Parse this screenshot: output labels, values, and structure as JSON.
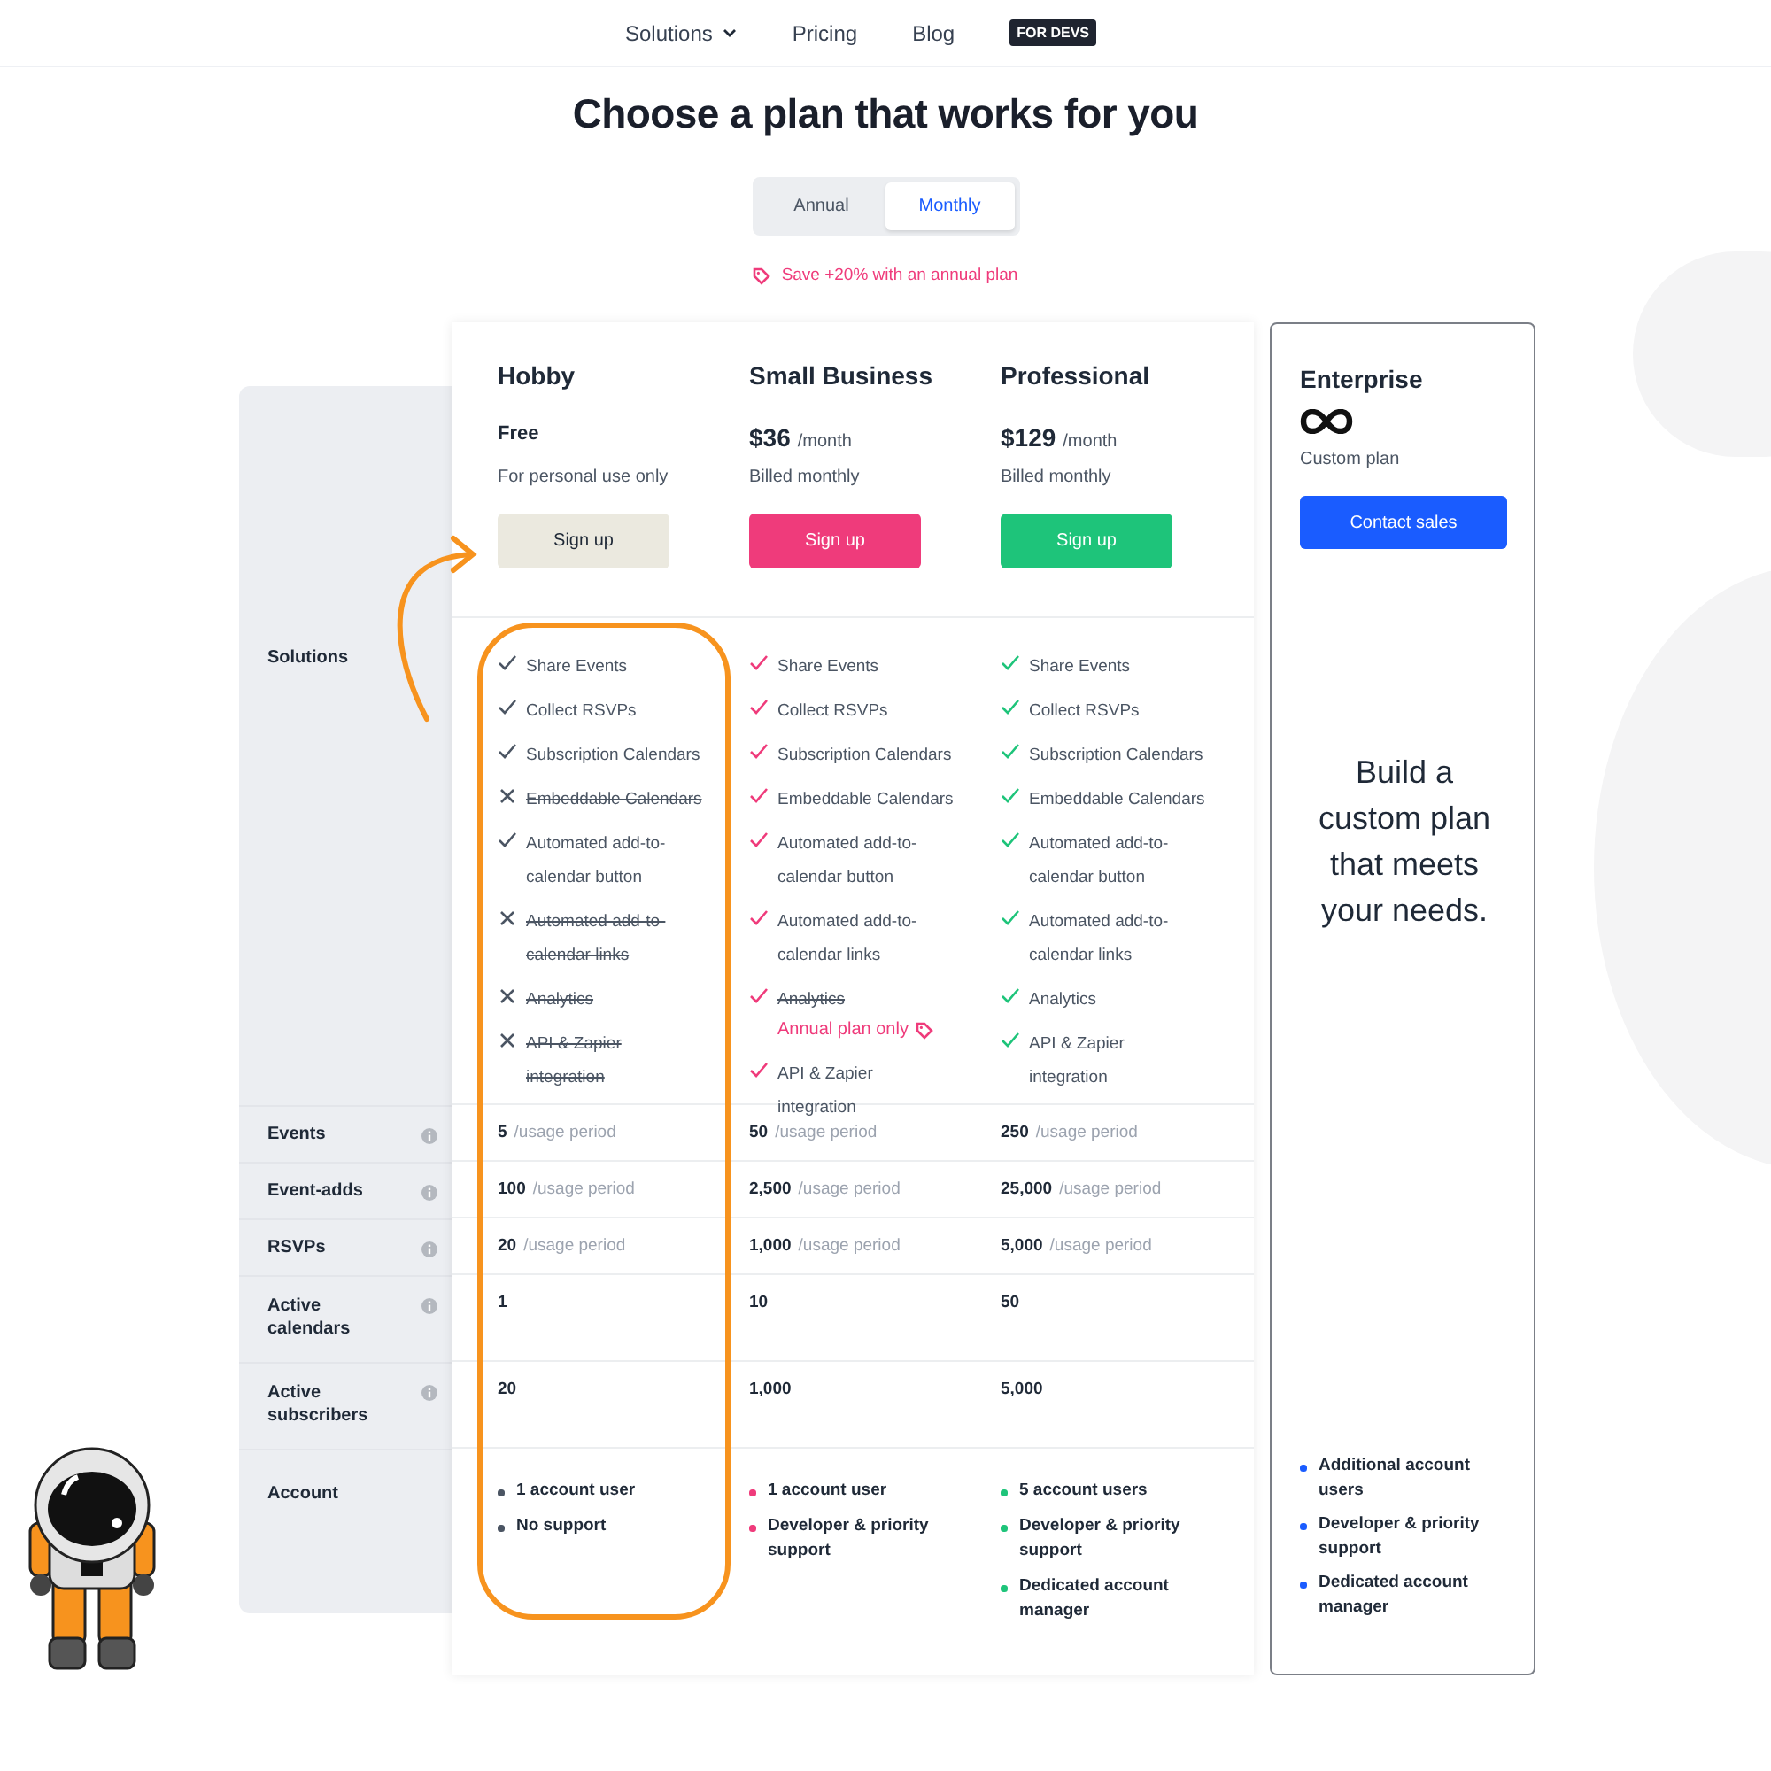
{
  "nav": {
    "items": [
      {
        "label": "Solutions",
        "kind": "dropdown"
      },
      {
        "label": "Pricing",
        "kind": "link"
      },
      {
        "label": "Blog",
        "kind": "link"
      },
      {
        "label": "FOR DEVS",
        "kind": "badge"
      }
    ]
  },
  "title": "Choose a plan that works for you",
  "billing_toggle": [
    {
      "label": "Annual",
      "selected": false
    },
    {
      "label": "Monthly",
      "selected": true
    }
  ],
  "promo": "Save +20% with an annual plan",
  "rows": [
    {
      "label": "Solutions",
      "info": false,
      "kind": "features"
    },
    {
      "label": "Events",
      "info": true,
      "kind": "limit"
    },
    {
      "label": "Event-adds",
      "info": true,
      "kind": "limit"
    },
    {
      "label": "RSVPs",
      "info": true,
      "kind": "limit"
    },
    {
      "label": "Active calendars",
      "info": true,
      "kind": "limit_tall"
    },
    {
      "label": "Active subscribers",
      "info": true,
      "kind": "limit_tall"
    },
    {
      "label": "Account",
      "info": false,
      "kind": "account"
    }
  ],
  "plans": [
    {
      "name": "Hobby",
      "price": "Free",
      "billing_note": "For personal use only",
      "color": "#4b5563",
      "button": {
        "label": "Sign up",
        "color": "#ebe9df",
        "kind": "neutral"
      },
      "features": [
        {
          "text": "Share Events",
          "kind": "check",
          "struck": false
        },
        {
          "text": "Collect RSVPs",
          "kind": "check",
          "struck": false
        },
        {
          "text": "Subscription Calendars",
          "kind": "check",
          "struck": false
        },
        {
          "text": "Embeddable Calendars",
          "kind": "cross",
          "struck": true
        },
        {
          "text": "Automated add-to-calendar button",
          "kind": "check",
          "struck": false
        },
        {
          "text": "Automated add-to-calendar links",
          "kind": "cross",
          "struck": true
        },
        {
          "text": "Analytics",
          "kind": "cross",
          "struck": true
        },
        {
          "text": "API & Zapier integration",
          "kind": "cross",
          "struck": true
        }
      ],
      "limits": [
        {
          "amount": "5",
          "unit": "/usage period"
        },
        {
          "amount": "100",
          "unit": "/usage period"
        },
        {
          "amount": "20",
          "unit": "/usage period"
        },
        {
          "amount": "1"
        },
        {
          "amount": "20"
        }
      ],
      "account": [
        "1 account user",
        "No support"
      ]
    },
    {
      "name": "Small Business",
      "price": "$36",
      "price_unit": "/month",
      "billing_note": "Billed monthly",
      "color": "#ef3b7b",
      "button": {
        "label": "Sign up",
        "color": "#ef3b7b",
        "kind": "filled"
      },
      "features": [
        {
          "text": "Share Events",
          "kind": "check",
          "struck": false
        },
        {
          "text": "Collect RSVPs",
          "kind": "check",
          "struck": false
        },
        {
          "text": "Subscription Calendars",
          "kind": "check",
          "struck": false
        },
        {
          "text": "Embeddable Calendars",
          "kind": "check",
          "struck": false
        },
        {
          "text": "Automated add-to-calendar button",
          "kind": "check",
          "struck": false
        },
        {
          "text": "Automated add-to-calendar links",
          "kind": "check",
          "struck": false
        },
        {
          "text": "Analytics",
          "kind": "check",
          "struck": true,
          "note": "Annual plan only"
        },
        {
          "text": "API & Zapier integration",
          "kind": "check",
          "struck": false
        }
      ],
      "limits": [
        {
          "amount": "50",
          "unit": "/usage period"
        },
        {
          "amount": "2,500",
          "unit": "/usage period"
        },
        {
          "amount": "1,000",
          "unit": "/usage period"
        },
        {
          "amount": "10"
        },
        {
          "amount": "1,000"
        }
      ],
      "account": [
        "1 account user",
        "Developer & priority support"
      ]
    },
    {
      "name": "Professional",
      "price": "$129",
      "price_unit": "/month",
      "billing_note": "Billed monthly",
      "color": "#1ec47a",
      "button": {
        "label": "Sign up",
        "color": "#1ec47a",
        "kind": "filled"
      },
      "features": [
        {
          "text": "Share Events",
          "kind": "check",
          "struck": false
        },
        {
          "text": "Collect RSVPs",
          "kind": "check",
          "struck": false
        },
        {
          "text": "Subscription Calendars",
          "kind": "check",
          "struck": false
        },
        {
          "text": "Embeddable Calendars",
          "kind": "check",
          "struck": false
        },
        {
          "text": "Automated add-to-calendar button",
          "kind": "check",
          "struck": false
        },
        {
          "text": "Automated add-to-calendar links",
          "kind": "check",
          "struck": false
        },
        {
          "text": "Analytics",
          "kind": "check",
          "struck": false
        },
        {
          "text": "API & Zapier integration",
          "kind": "check",
          "struck": false
        }
      ],
      "limits": [
        {
          "amount": "250",
          "unit": "/usage period"
        },
        {
          "amount": "25,000",
          "unit": "/usage period"
        },
        {
          "amount": "5,000",
          "unit": "/usage period"
        },
        {
          "amount": "50"
        },
        {
          "amount": "5,000"
        }
      ],
      "account": [
        "5 account users",
        "Developer & priority support",
        "Dedicated account manager"
      ]
    }
  ],
  "enterprise": {
    "name": "Enterprise",
    "billing_note": "Custom plan",
    "color": "#1a5cff",
    "button": {
      "label": "Contact sales"
    },
    "blurb": "Build a custom plan that meets your needs.",
    "account": [
      "Additional account users",
      "Developer & priority support",
      "Dedicated account manager"
    ]
  }
}
